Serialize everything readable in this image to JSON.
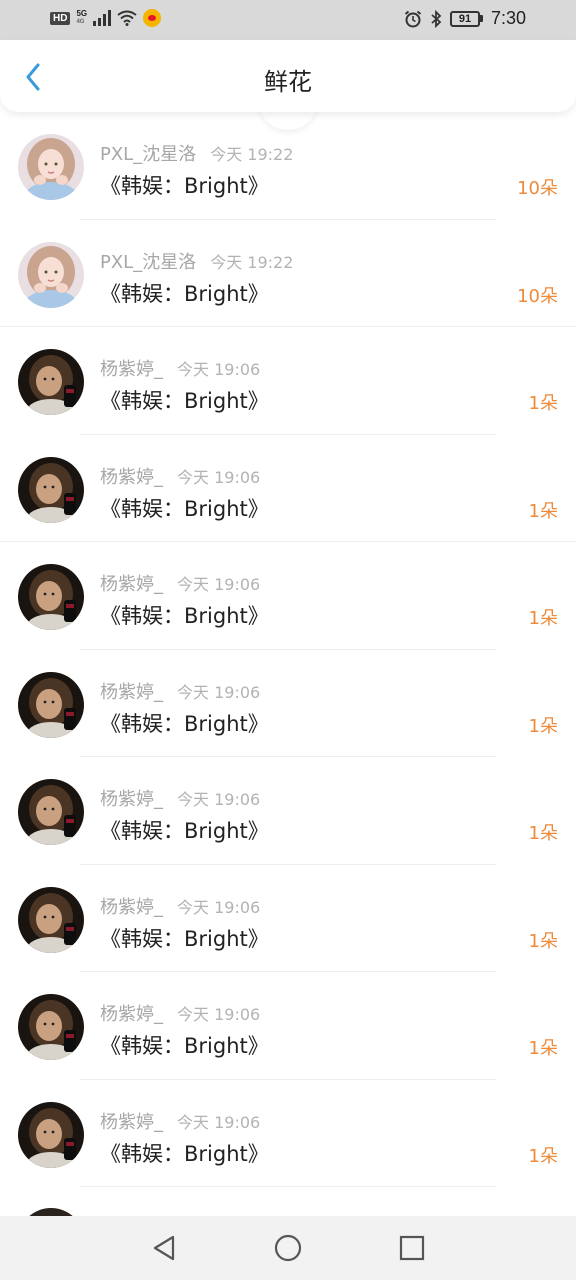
{
  "status_bar": {
    "hd": "HD",
    "net_top": "5G",
    "net_bottom": "4G",
    "battery": "91",
    "time": "7:30"
  },
  "header": {
    "title": "鲜花",
    "back_icon": "chevron-left-icon"
  },
  "colors": {
    "accent": "#3a9bdc",
    "count": "#ee8a3a"
  },
  "items": [
    {
      "user": "PXL_沈星洛",
      "time": "今天 19:22",
      "book": "《韩娱：Bright》",
      "count": "10朵",
      "avatar": "girl"
    },
    {
      "user": "PXL_沈星洛",
      "time": "今天 19:22",
      "book": "《韩娱：Bright》",
      "count": "10朵",
      "avatar": "girl"
    },
    {
      "user": "杨紫婷_",
      "time": "今天 19:06",
      "book": "《韩娱：Bright》",
      "count": "1朵",
      "avatar": "portrait"
    },
    {
      "user": "杨紫婷_",
      "time": "今天 19:06",
      "book": "《韩娱：Bright》",
      "count": "1朵",
      "avatar": "portrait"
    },
    {
      "user": "杨紫婷_",
      "time": "今天 19:06",
      "book": "《韩娱：Bright》",
      "count": "1朵",
      "avatar": "portrait"
    },
    {
      "user": "杨紫婷_",
      "time": "今天 19:06",
      "book": "《韩娱：Bright》",
      "count": "1朵",
      "avatar": "portrait"
    },
    {
      "user": "杨紫婷_",
      "time": "今天 19:06",
      "book": "《韩娱：Bright》",
      "count": "1朵",
      "avatar": "portrait"
    },
    {
      "user": "杨紫婷_",
      "time": "今天 19:06",
      "book": "《韩娱：Bright》",
      "count": "1朵",
      "avatar": "portrait"
    },
    {
      "user": "杨紫婷_",
      "time": "今天 19:06",
      "book": "《韩娱：Bright》",
      "count": "1朵",
      "avatar": "portrait"
    },
    {
      "user": "杨紫婷_",
      "time": "今天 19:06",
      "book": "《韩娱：Bright》",
      "count": "1朵",
      "avatar": "portrait"
    }
  ],
  "nav": {
    "back": "triangle-back-icon",
    "home": "circle-home-icon",
    "recent": "square-recent-icon"
  }
}
